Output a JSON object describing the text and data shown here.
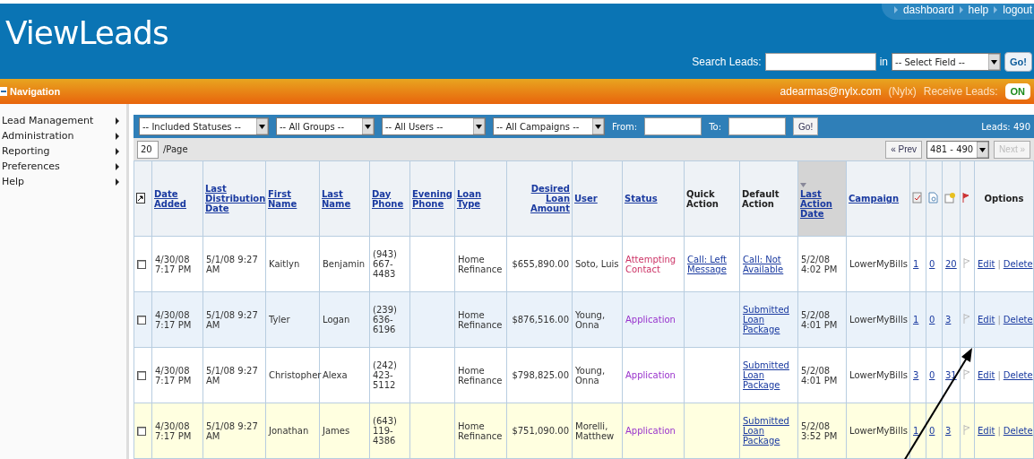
{
  "header": {
    "logo": "ViewLeads",
    "links": [
      "dashboard",
      "help",
      "logout"
    ],
    "search": {
      "label": "Search Leads:",
      "in_label": "in",
      "field_select": "-- Select Field --",
      "go": "Go!"
    }
  },
  "nav_bar": {
    "title": "Navigation",
    "user": "adearmas@nylx.com",
    "org": "(Nylx)",
    "receive_label": "Receive Leads:",
    "receive_toggle": "ON"
  },
  "sidebar": {
    "items": [
      "Lead Management",
      "Administration",
      "Reporting",
      "Preferences",
      "Help"
    ]
  },
  "filters": {
    "selects": [
      {
        "value": "-- Included Statuses --",
        "wide": false
      },
      {
        "value": "-- All Groups --",
        "wide": false
      },
      {
        "value": "-- All Users --",
        "wide": true
      },
      {
        "value": "-- All Campaigns --",
        "wide": false
      }
    ],
    "from_label": "From:",
    "to_label": "To:",
    "go": "Go!",
    "count": "Leads: 490"
  },
  "paging": {
    "per_page": "20",
    "per_page_label": "/Page",
    "prev": {
      "label": "« Prev",
      "disabled": false
    },
    "range": "481 - 490",
    "next": {
      "label": "Next »",
      "disabled": true
    }
  },
  "table": {
    "columns": [
      {
        "label": "Date Added",
        "link": true,
        "sorted": false
      },
      {
        "label": "Last Distribution Date",
        "link": true,
        "sorted": false
      },
      {
        "label": "First Name",
        "link": true,
        "sorted": false
      },
      {
        "label": "Last Name",
        "link": true,
        "sorted": false
      },
      {
        "label": "Day Phone",
        "link": true,
        "sorted": false
      },
      {
        "label": "Evening Phone",
        "link": true,
        "sorted": false
      },
      {
        "label": "Loan Type",
        "link": true,
        "sorted": false
      },
      {
        "label": "Desired Loan Amount",
        "link": true,
        "sorted": false
      },
      {
        "label": "User",
        "link": true,
        "sorted": false
      },
      {
        "label": "Status",
        "link": true,
        "sorted": false
      },
      {
        "label": "Quick Action",
        "link": false,
        "sorted": false
      },
      {
        "label": "Default Action",
        "link": false,
        "sorted": false
      },
      {
        "label": "Last Action Date",
        "link": true,
        "sorted": true
      },
      {
        "label": "Campaign",
        "link": true,
        "sorted": false
      }
    ],
    "options_label": "Options",
    "rows": [
      {
        "color": "#ffffff",
        "checked": false,
        "date_added": "4/30/08 7:17 PM",
        "last_distribution": "5/1/08 9:27 AM",
        "first_name": "Kaitlyn",
        "last_name": "Benjamin",
        "day_phone": "(943) 667-4483",
        "loan_type": "Home Refinance",
        "amount": "$655,890.00",
        "user": "Soto, Luis",
        "status": {
          "text": "Attempting Contact",
          "color": "#cc3366"
        },
        "quick_action": "Call: Left Message",
        "default_action": "Call: Not Available",
        "last_action": "5/2/08 4:02 PM",
        "campaign": "LowerMyBills",
        "counts": [
          "1",
          "0",
          "20"
        ],
        "edit": "Edit",
        "separator": "|",
        "delete": "Delete"
      },
      {
        "color": "#eaf2fa",
        "checked": false,
        "date_added": "4/30/08 7:17 PM",
        "last_distribution": "5/1/08 9:27 AM",
        "first_name": "Tyler",
        "last_name": "Logan",
        "day_phone": "(239) 636-6196",
        "loan_type": "Home Refinance",
        "amount": "$876,516.00",
        "user": "Young, Onna",
        "status": {
          "text": "Application",
          "color": "#9933cc"
        },
        "default_action": "Submitted Loan Package",
        "last_action": "5/2/08 4:01 PM",
        "campaign": "LowerMyBills",
        "counts": [
          "1",
          "0",
          "3"
        ],
        "edit": "Edit",
        "separator": "|",
        "delete": "Delete"
      },
      {
        "color": "#ffffff",
        "checked": false,
        "date_added": "4/30/08 7:17 PM",
        "last_distribution": "5/1/08 9:27 AM",
        "first_name": "Christopher",
        "last_name": "Alexa",
        "day_phone": "(242) 423-5112",
        "loan_type": "Home Refinance",
        "amount": "$798,825.00",
        "user": "Young, Onna",
        "status": {
          "text": "Application",
          "color": "#9933cc"
        },
        "default_action": "Submitted Loan Package",
        "last_action": "5/2/08 4:01 PM",
        "campaign": "LowerMyBills",
        "counts": [
          "3",
          "0",
          "31"
        ],
        "edit": "Edit",
        "separator": "|",
        "delete": "Delete"
      },
      {
        "color": "#ffffe0",
        "checked": false,
        "date_added": "4/30/08 7:17 PM",
        "last_distribution": "5/1/08 9:27 AM",
        "first_name": "Jonathan",
        "last_name": "James",
        "day_phone": "(643) 119-4386",
        "loan_type": "Home Refinance",
        "amount": "$751,090.00",
        "user": "Morelli, Matthew",
        "status": {
          "text": "Application",
          "color": "#9933cc"
        },
        "default_action": "Submitted Loan Package",
        "last_action": "5/2/08 3:52 PM",
        "campaign": "LowerMyBills",
        "counts": [
          "1",
          "0",
          "3"
        ],
        "edit": "Edit",
        "separator": "|",
        "delete": "Delete"
      }
    ]
  }
}
